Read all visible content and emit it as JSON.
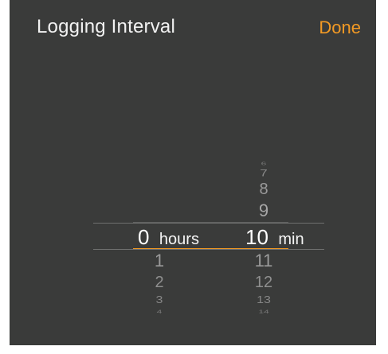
{
  "header": {
    "title": "Logging Interval",
    "done_label": "Done"
  },
  "picker": {
    "hours": {
      "selected": "0",
      "unit": "hours",
      "visible_below": [
        "1",
        "2",
        "3",
        "4"
      ]
    },
    "minutes": {
      "selected": "10",
      "unit": "min",
      "visible_above": [
        "6",
        "7",
        "8",
        "9"
      ],
      "visible_below": [
        "11",
        "12",
        "13",
        "14"
      ]
    }
  },
  "colors": {
    "background": "#3a3b3a",
    "accent": "#f39a24",
    "text": "#f2f2f2"
  }
}
